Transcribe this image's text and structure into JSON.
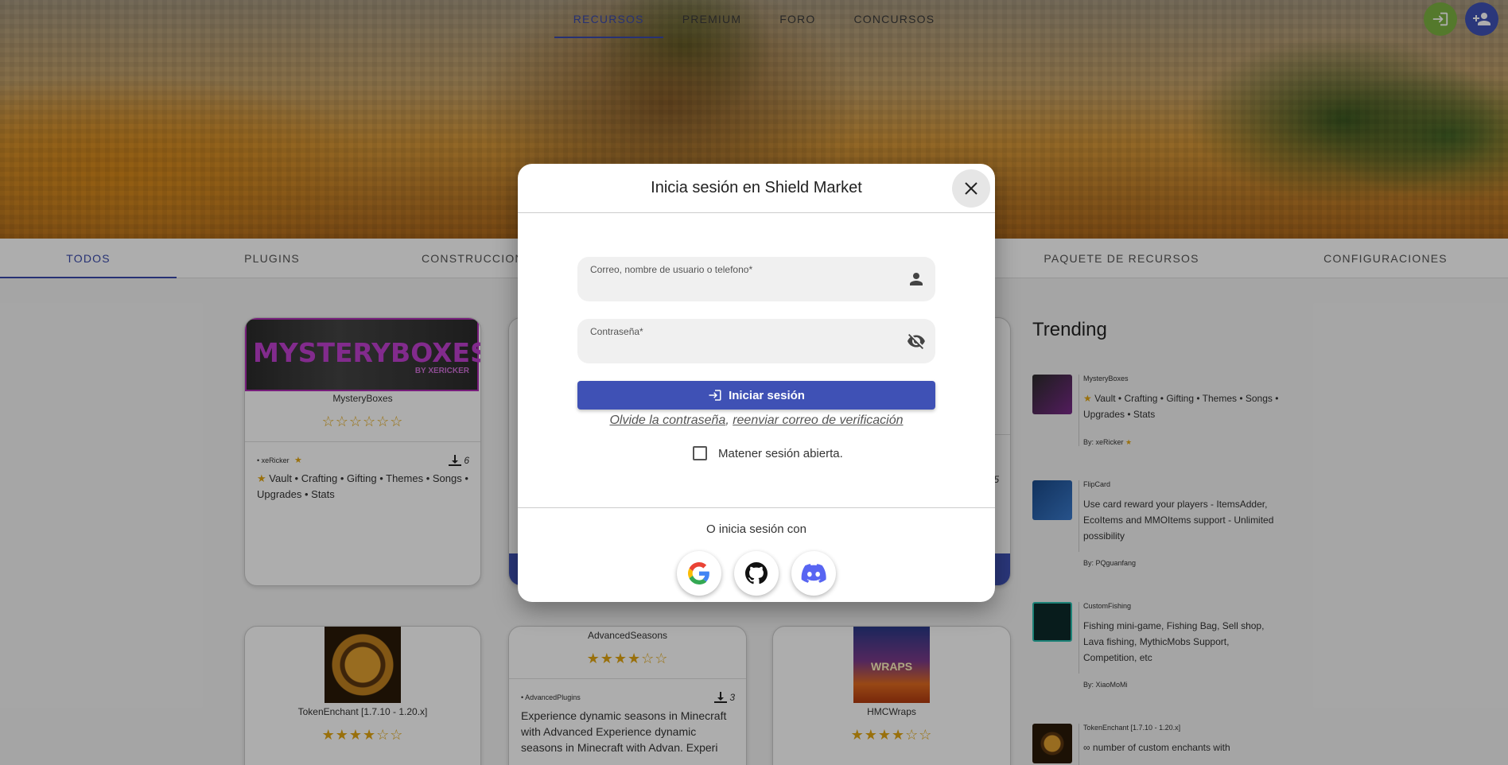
{
  "topnav": {
    "items": [
      "RECURSOS",
      "PREMIUM",
      "FORO",
      "CONCURSOS"
    ]
  },
  "categories": [
    "TODOS",
    "PLUGINS",
    "CONSTRUCCIONES",
    "PAQUETE DE RECURSOS",
    "CONFIGURACIONES"
  ],
  "cards": {
    "mysteryboxes": {
      "banner_title": "MYSTERYBOXES",
      "banner_sub": "BY XERICKER",
      "title": "MysteryBoxes",
      "stars": "☆☆☆☆☆☆",
      "author": "• xeRicker",
      "downloads": "6",
      "desc": "Vault • Crafting • Gifting • Themes • Songs • Upgrades • Stats"
    },
    "tokenenchant": {
      "title": "TokenEnchant [1.7.10 - 1.20.x]",
      "stars": "★★★★☆☆"
    },
    "advancedseasons": {
      "title": "AdvancedSeasons",
      "stars": "★★★★☆☆",
      "author": "• AdvancedPlugins",
      "downloads": "3",
      "desc": "Experience dynamic seasons in Minecraft with Advanced Experience dynamic seasons in Minecraft with Advan. Experi"
    },
    "hmcwraps": {
      "title": "HMCWraps",
      "stars": "★★★★☆☆",
      "banner_text": "WRAPS"
    },
    "hidden_downloads": "5"
  },
  "trending": {
    "title": "Trending",
    "items": [
      {
        "name": "MysteryBoxes",
        "desc": "Vault • Crafting • Gifting • Themes • Songs • Upgrades • Stats",
        "author": "By: xeRicker"
      },
      {
        "name": "FlipCard",
        "desc": "Use card reward your players - ItemsAdder, EcoItems and MMOItems support - Unlimited possibility",
        "author": "By: PQguanfang"
      },
      {
        "name": "CustomFishing",
        "desc": "Fishing mini-game, Fishing Bag, Sell shop, Lava fishing, MythicMobs Support, Competition, etc",
        "author": "By: XiaoMoMi"
      },
      {
        "name": "TokenEnchant [1.7.10 - 1.20.x]",
        "desc": "∞ number of custom enchants with"
      }
    ]
  },
  "modal": {
    "title": "Inicia sesión en Shield Market",
    "user_label": "Correo, nombre de usuario o telefono*",
    "user_value": "",
    "password_label": "Contraseña*",
    "password_value": "",
    "login_button": "Iniciar sesión",
    "forgot_link": "Olvide la contraseña",
    "separator": ", ",
    "resend_link": "reenviar correo de verificación",
    "remember_label": "Matener sesión abierta.",
    "alt_label": "O inicia sesión con",
    "colors": {
      "primary": "#3f51b5",
      "login_fab": "#7cb342",
      "discord": "#5865f2"
    }
  }
}
